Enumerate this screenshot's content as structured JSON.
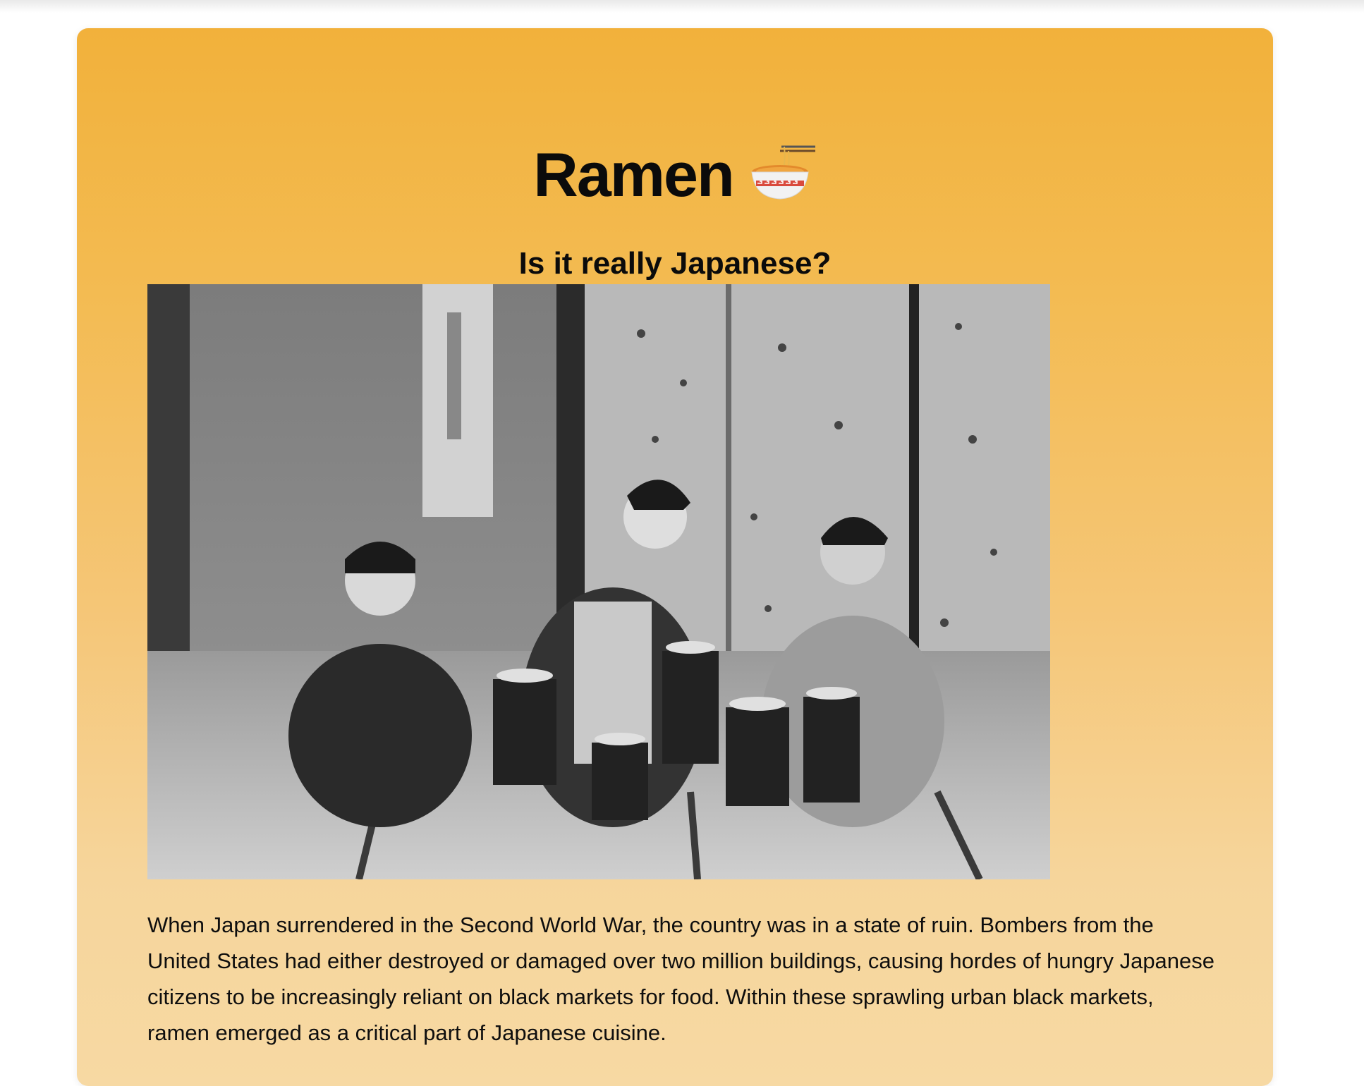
{
  "page": {
    "title": "Ramen",
    "title_icon": "ramen-bowl-icon",
    "subtitle": "Is it really Japanese?",
    "photo_icon": "historic-photo-women-eating-noodles",
    "paragraph": "When Japan surrendered in the Second World War, the country was in a state of ruin. Bombers from the United States had either destroyed or damaged over two million buildings, causing hordes of hungry Japanese citizens to be increasingly reliant on black markets for food. Within these sprawling urban black markets, ramen emerged as a critical part of Japanese cuisine."
  },
  "colors": {
    "card_top": "#f2b13b",
    "card_bottom": "#f7d9a3",
    "text": "#0b0b0b"
  }
}
